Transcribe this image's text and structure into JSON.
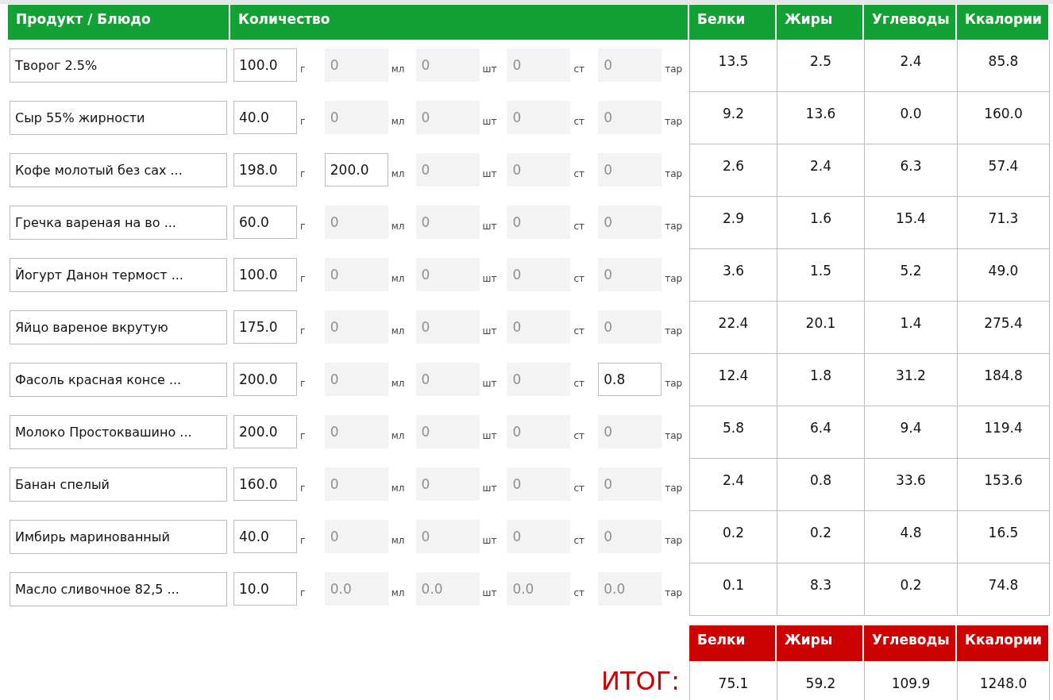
{
  "header": {
    "columns": [
      "Продукт / Блюдо",
      "Количество",
      "Белки",
      "Жиры",
      "Углеводы",
      "Ккалории"
    ]
  },
  "rows": [
    {
      "name": "Творог 2.5%",
      "fields": [
        {
          "value": "100.0",
          "unit": "г",
          "disabled": false
        },
        {
          "placeholder": "0",
          "unit": "мл",
          "disabled": true
        },
        {
          "placeholder": "0",
          "unit": "шт",
          "disabled": true
        },
        {
          "placeholder": "0",
          "unit": "ст",
          "disabled": true
        },
        {
          "placeholder": "0",
          "unit": "тар",
          "disabled": true
        }
      ],
      "protein": "13.5",
      "fat": "2.5",
      "carbs": "2.4",
      "kcal": "85.8"
    },
    {
      "name": "Сыр 55% жирности",
      "fields": [
        {
          "value": "40.0",
          "unit": "г",
          "disabled": false
        },
        {
          "placeholder": "0",
          "unit": "мл",
          "disabled": true
        },
        {
          "placeholder": "0",
          "unit": "шт",
          "disabled": true
        },
        {
          "placeholder": "0",
          "unit": "ст",
          "disabled": true
        },
        {
          "placeholder": "0",
          "unit": "тар",
          "disabled": true
        }
      ],
      "protein": "9.2",
      "fat": "13.6",
      "carbs": "0.0",
      "kcal": "160.0"
    },
    {
      "name": "Кофе молотый без сах ...",
      "fields": [
        {
          "value": "198.0",
          "unit": "г",
          "disabled": false
        },
        {
          "value": "200.0",
          "unit": "мл",
          "disabled": false
        },
        {
          "placeholder": "0",
          "unit": "шт",
          "disabled": true
        },
        {
          "placeholder": "0",
          "unit": "ст",
          "disabled": true
        },
        {
          "placeholder": "0",
          "unit": "тар",
          "disabled": true
        }
      ],
      "protein": "2.6",
      "fat": "2.4",
      "carbs": "6.3",
      "kcal": "57.4"
    },
    {
      "name": "Гречка вареная на во ...",
      "fields": [
        {
          "value": "60.0",
          "unit": "г",
          "disabled": false
        },
        {
          "placeholder": "0",
          "unit": "мл",
          "disabled": true
        },
        {
          "placeholder": "0",
          "unit": "шт",
          "disabled": true
        },
        {
          "placeholder": "0",
          "unit": "ст",
          "disabled": true
        },
        {
          "placeholder": "0",
          "unit": "тар",
          "disabled": true
        }
      ],
      "protein": "2.9",
      "fat": "1.6",
      "carbs": "15.4",
      "kcal": "71.3"
    },
    {
      "name": "Йогурт Данон термост ...",
      "fields": [
        {
          "value": "100.0",
          "unit": "г",
          "disabled": false
        },
        {
          "placeholder": "0",
          "unit": "мл",
          "disabled": true
        },
        {
          "placeholder": "0",
          "unit": "шт",
          "disabled": true
        },
        {
          "placeholder": "0",
          "unit": "ст",
          "disabled": true
        },
        {
          "placeholder": "0",
          "unit": "тар",
          "disabled": true
        }
      ],
      "protein": "3.6",
      "fat": "1.5",
      "carbs": "5.2",
      "kcal": "49.0"
    },
    {
      "name": "Яйцо вареное вкрутую",
      "fields": [
        {
          "value": "175.0",
          "unit": "г",
          "disabled": false
        },
        {
          "placeholder": "0",
          "unit": "мл",
          "disabled": true
        },
        {
          "placeholder": "0",
          "unit": "шт",
          "disabled": true
        },
        {
          "placeholder": "0",
          "unit": "ст",
          "disabled": true
        },
        {
          "placeholder": "0",
          "unit": "тар",
          "disabled": true
        }
      ],
      "protein": "22.4",
      "fat": "20.1",
      "carbs": "1.4",
      "kcal": "275.4"
    },
    {
      "name": "Фасоль красная консе ...",
      "fields": [
        {
          "value": "200.0",
          "unit": "г",
          "disabled": false
        },
        {
          "placeholder": "0",
          "unit": "мл",
          "disabled": true
        },
        {
          "placeholder": "0",
          "unit": "шт",
          "disabled": true
        },
        {
          "placeholder": "0",
          "unit": "ст",
          "disabled": true
        },
        {
          "value": "0.8",
          "unit": "тар",
          "disabled": false
        }
      ],
      "protein": "12.4",
      "fat": "1.8",
      "carbs": "31.2",
      "kcal": "184.8"
    },
    {
      "name": "Молоко Простоквашино ...",
      "fields": [
        {
          "value": "200.0",
          "unit": "г",
          "disabled": false
        },
        {
          "placeholder": "0",
          "unit": "мл",
          "disabled": true
        },
        {
          "placeholder": "0",
          "unit": "шт",
          "disabled": true
        },
        {
          "placeholder": "0",
          "unit": "ст",
          "disabled": true
        },
        {
          "placeholder": "0",
          "unit": "тар",
          "disabled": true
        }
      ],
      "protein": "5.8",
      "fat": "6.4",
      "carbs": "9.4",
      "kcal": "119.4"
    },
    {
      "name": "Банан спелый",
      "fields": [
        {
          "value": "160.0",
          "unit": "г",
          "disabled": false
        },
        {
          "placeholder": "0",
          "unit": "мл",
          "disabled": true
        },
        {
          "placeholder": "0",
          "unit": "шт",
          "disabled": true
        },
        {
          "placeholder": "0",
          "unit": "ст",
          "disabled": true
        },
        {
          "placeholder": "0",
          "unit": "тар",
          "disabled": true
        }
      ],
      "protein": "2.4",
      "fat": "0.8",
      "carbs": "33.6",
      "kcal": "153.6"
    },
    {
      "name": "Имбирь маринованный",
      "fields": [
        {
          "value": "40.0",
          "unit": "г",
          "disabled": false
        },
        {
          "placeholder": "0",
          "unit": "мл",
          "disabled": true
        },
        {
          "placeholder": "0",
          "unit": "шт",
          "disabled": true
        },
        {
          "placeholder": "0",
          "unit": "ст",
          "disabled": true
        },
        {
          "placeholder": "0",
          "unit": "тар",
          "disabled": true
        }
      ],
      "protein": "0.2",
      "fat": "0.2",
      "carbs": "4.8",
      "kcal": "16.5"
    },
    {
      "name": "Масло сливочное 82,5 ...",
      "fields": [
        {
          "value": "10.0",
          "unit": "г",
          "disabled": false
        },
        {
          "value": "0.0",
          "unit": "мл",
          "disabled": true
        },
        {
          "value": "0.0",
          "unit": "шт",
          "disabled": true
        },
        {
          "value": "0.0",
          "unit": "ст",
          "disabled": true
        },
        {
          "value": "0.0",
          "unit": "тар",
          "disabled": true
        }
      ],
      "protein": "0.1",
      "fat": "8.3",
      "carbs": "0.2",
      "kcal": "74.8"
    }
  ],
  "totals": {
    "label": "ИТОГ:",
    "columns": [
      "Белки",
      "Жиры",
      "Углеводы",
      "Ккалории"
    ],
    "values": [
      "75.1",
      "59.2",
      "109.9",
      "1248.0"
    ]
  }
}
